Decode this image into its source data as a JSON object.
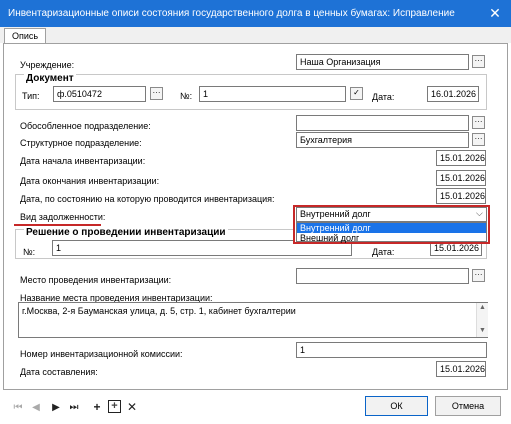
{
  "window": {
    "title": "Инвентаризационные описи состояния государственного долга в ценных бумагах: Исправление",
    "close_glyph": "✕"
  },
  "tabs": [
    {
      "label": "Опись"
    }
  ],
  "form": {
    "institution_label": "Учреждение:",
    "institution_value": "Наша Организация",
    "document_group_label": "Документ",
    "type_label": "Тип:",
    "type_value": "ф.0510472",
    "number_label": "№:",
    "number_value": "1",
    "date_label": "Дата:",
    "date_value": "16.01.2026",
    "separate_division_label": "Обособленное подразделение:",
    "separate_division_value": "",
    "structural_division_label": "Структурное подразделение:",
    "structural_division_value": "Бухгалтерия",
    "inv_start_label": "Дата начала инвентаризации:",
    "inv_start_value": "15.01.2026",
    "inv_end_label": "Дата окончания инвентаризации:",
    "inv_end_value": "15.01.2026",
    "as_of_label": "Дата, по состоянию на которую проводится инвентаризация:",
    "as_of_value": "15.01.2026",
    "debt_type_label": "Вид задолженности:",
    "debt_type_value": "Внутренний долг",
    "debt_type_options": [
      "Внутренний долг",
      "Внешний долг"
    ],
    "decision_group_label": "Решение о проведении инвентаризации",
    "decision_number_label": "№:",
    "decision_number_value": "1",
    "decision_date_label": "Дата:",
    "decision_date_value": "15.01.2026",
    "place_label": "Место проведения инвентаризации:",
    "place_value": "",
    "place_name_label": "Название места проведения инвентаризации:",
    "place_name_value": "г.Москва, 2-я Бауманская улица, д. 5, стр. 1, кабинет бухгалтерии",
    "commission_label": "Номер инвентаризационной комиссии:",
    "commission_value": "1",
    "compiled_label": "Дата составления:",
    "compiled_value": "15.01.2026"
  },
  "footer": {
    "ok_label": "ОК",
    "cancel_label": "Отмена"
  },
  "colors": {
    "title_bar": "#1e72d6",
    "highlight_red": "#c62828",
    "selection_blue": "#1a73e8"
  }
}
